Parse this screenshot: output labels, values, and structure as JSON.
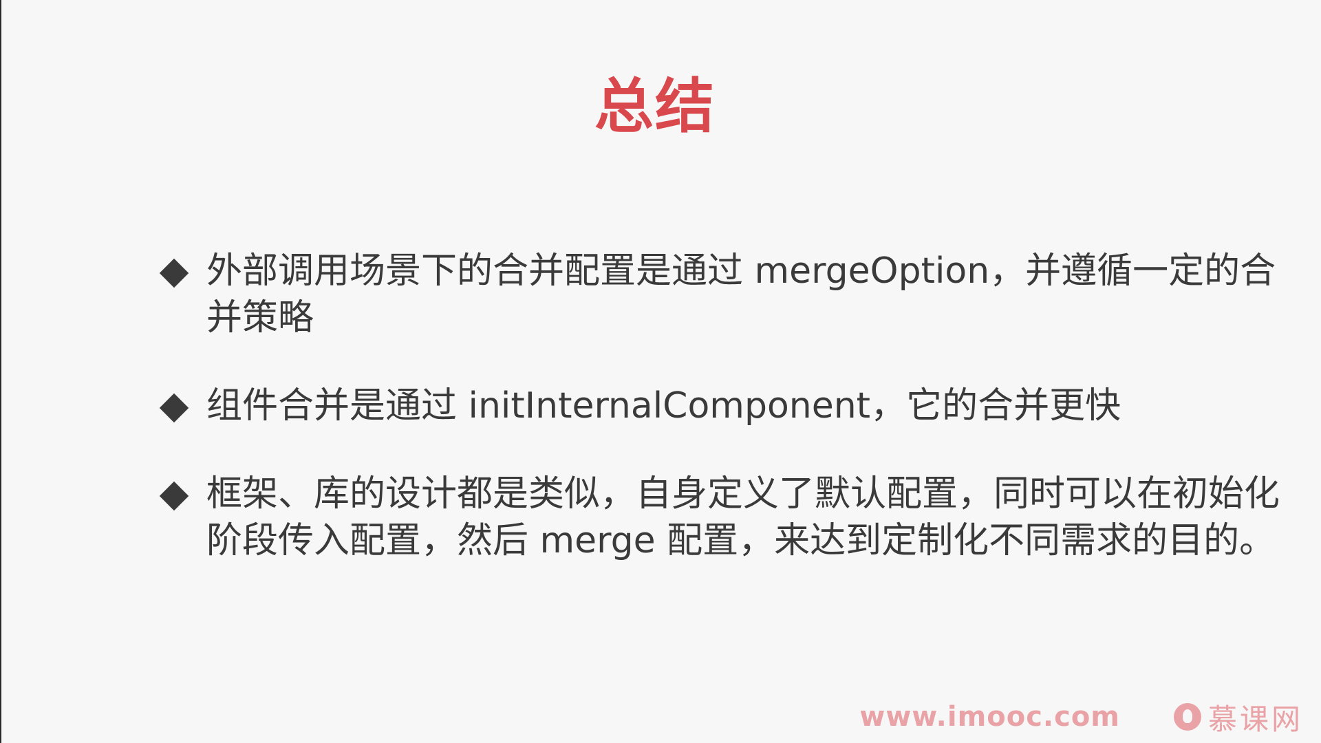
{
  "slide": {
    "title": "总结",
    "bullets": [
      "外部调用场景下的合并配置是通过 mergeOption，并遵循一定的合并策略",
      "组件合并是通过 initInternalComponent，它的合并更快",
      "框架、库的设计都是类似，自身定义了默认配置，同时可以在初始化阶段传入配置，然后 merge 配置，来达到定制化不同需求的目的。"
    ]
  },
  "watermark": {
    "url": "www.imooc.com",
    "brand": "慕课网",
    "icon": "imooc-flame-logo-icon"
  },
  "colors": {
    "title": "#d9484d",
    "text": "#3a3a3a",
    "background": "#f7f7f7",
    "watermark": "#e9a2a5"
  }
}
